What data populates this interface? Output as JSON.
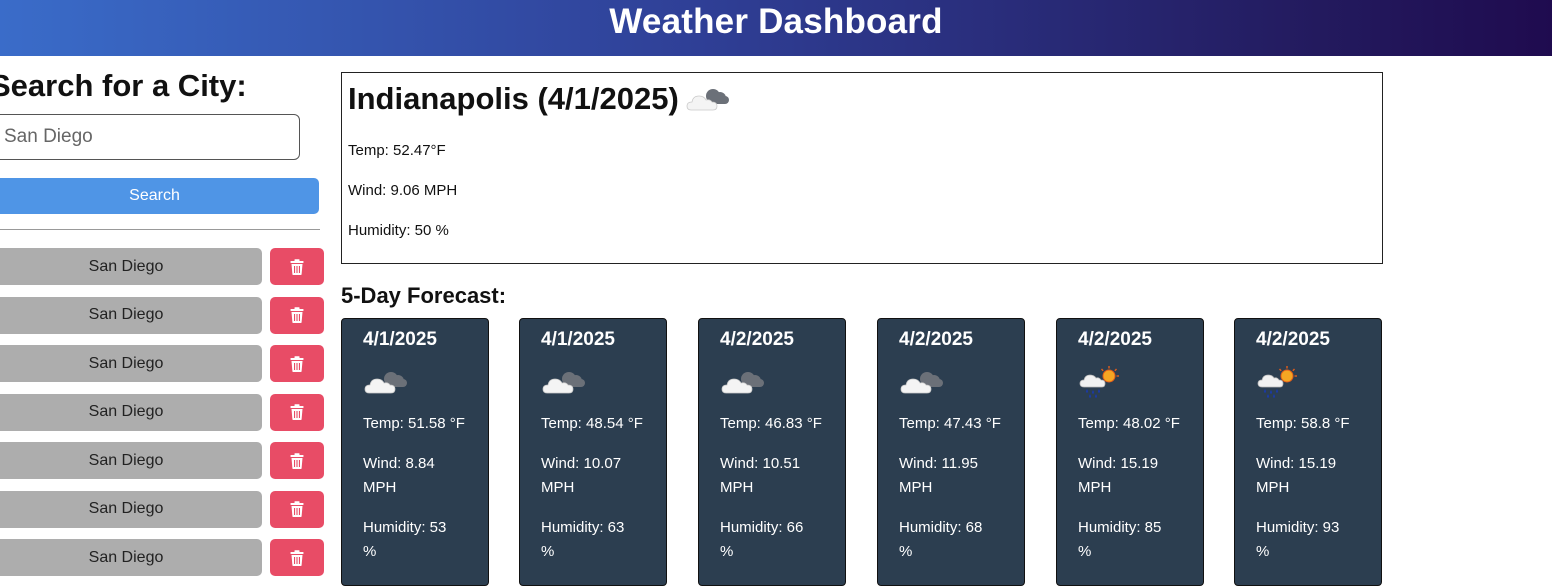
{
  "header": {
    "title": "Weather Dashboard"
  },
  "search": {
    "title": "Search for a City:",
    "input_value": "San Diego",
    "button_label": "Search"
  },
  "history": {
    "items": [
      {
        "label": "San Diego"
      },
      {
        "label": "San Diego"
      },
      {
        "label": "San Diego"
      },
      {
        "label": "San Diego"
      },
      {
        "label": "San Diego"
      },
      {
        "label": "San Diego"
      },
      {
        "label": "San Diego"
      }
    ],
    "delete_icon": "trash-icon"
  },
  "current": {
    "title": "Indianapolis (4/1/2025)",
    "icon": "cloudy-icon",
    "temp": "Temp: 52.47°F",
    "wind": "Wind: 9.06 MPH",
    "humidity": "Humidity: 50 %"
  },
  "forecast": {
    "title": "5-Day Forecast:",
    "cards": [
      {
        "date": "4/1/2025",
        "icon": "cloudy-icon",
        "temp": "Temp: 51.58 °F",
        "wind1": "Wind: 8.84",
        "wind2": "MPH",
        "hum1": "Humidity: 53",
        "hum2": "%"
      },
      {
        "date": "4/1/2025",
        "icon": "cloudy-icon",
        "temp": "Temp: 48.54 °F",
        "wind1": "Wind: 10.07",
        "wind2": "MPH",
        "hum1": "Humidity: 63",
        "hum2": "%"
      },
      {
        "date": "4/2/2025",
        "icon": "cloudy-icon",
        "temp": "Temp: 46.83 °F",
        "wind1": "Wind: 10.51",
        "wind2": "MPH",
        "hum1": "Humidity: 66",
        "hum2": "%"
      },
      {
        "date": "4/2/2025",
        "icon": "cloudy-icon",
        "temp": "Temp: 47.43 °F",
        "wind1": "Wind: 11.95",
        "wind2": "MPH",
        "hum1": "Humidity: 68",
        "hum2": "%"
      },
      {
        "date": "4/2/2025",
        "icon": "rain-sun-icon",
        "temp": "Temp: 48.02 °F",
        "wind1": "Wind: 15.19",
        "wind2": "MPH",
        "hum1": "Humidity: 85",
        "hum2": "%"
      },
      {
        "date": "4/2/2025",
        "icon": "rain-sun-icon",
        "temp": "Temp: 58.8 °F",
        "wind1": "Wind: 15.19",
        "wind2": "MPH",
        "hum1": "Humidity: 93",
        "hum2": "%"
      }
    ]
  },
  "colors": {
    "search_button": "#4f95e6",
    "history_button": "#adadad",
    "delete_button": "#e84c66",
    "card_bg": "#2c3e50"
  }
}
